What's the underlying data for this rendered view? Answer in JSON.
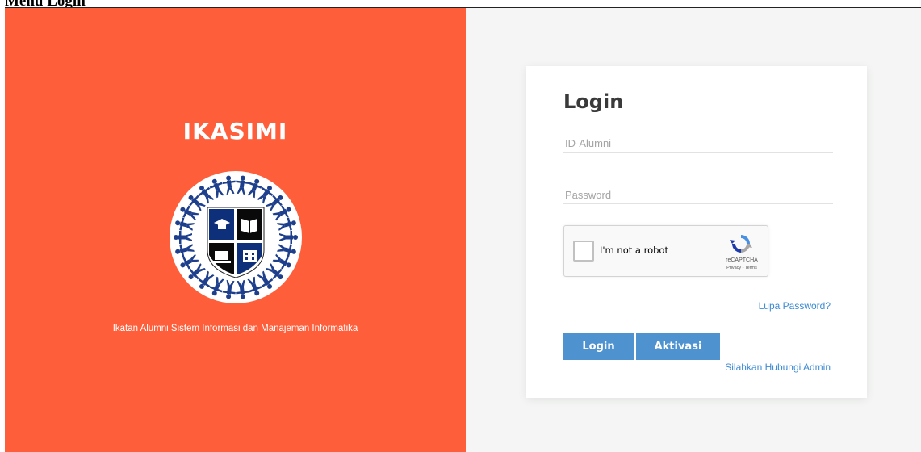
{
  "page": {
    "heading": "Menu Login"
  },
  "brand": {
    "title": "IKASIMI",
    "tagline": "Ikatan Alumni Sistem Informasi dan Manajeman Informatika",
    "panel_color": "#ff5e3a",
    "logo_icon": "ikasimi-emblem-icon"
  },
  "login_form": {
    "title": "Login",
    "id_placeholder": "ID-Alumni",
    "id_value": "",
    "password_placeholder": "Password",
    "password_value": "",
    "captcha": {
      "label": "I'm not a robot",
      "brand": "reCAPTCHA",
      "links": "Privacy - Terms",
      "checked": false
    },
    "forgot_password": "Lupa Password?",
    "login_button": "Login",
    "activate_button": "Aktivasi",
    "contact_admin": "Silahkan Hubungi Admin",
    "accent_color": "#4e92cf",
    "link_color": "#3d8bd4"
  }
}
